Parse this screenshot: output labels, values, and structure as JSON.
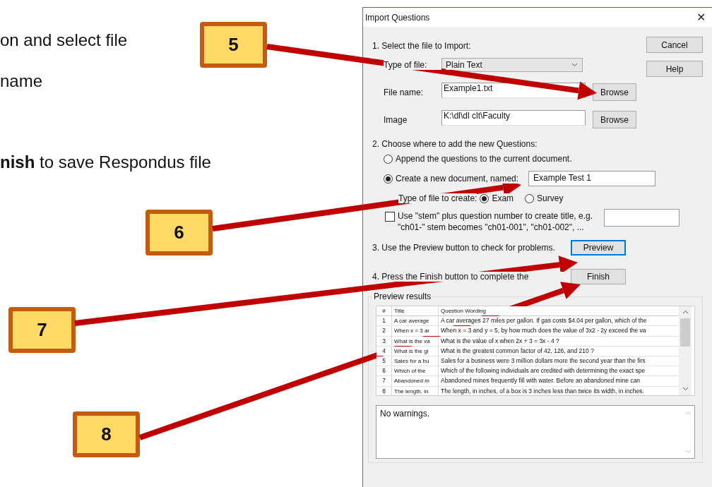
{
  "slide_text": [
    "on and select file",
    "name",
    "**nish** to save Respondus file"
  ],
  "callouts": [
    {
      "label": "5"
    },
    {
      "label": "6"
    },
    {
      "label": "7"
    },
    {
      "label": "8"
    }
  ],
  "dialog": {
    "title": "Import Questions",
    "close": "✕",
    "side_buttons": [
      {
        "label": "Cancel"
      },
      {
        "label": "Help"
      }
    ],
    "step1": "1.  Select the file to Import:",
    "type_of_file": {
      "label": "Type of file:",
      "value": "Plain Text"
    },
    "file_name": {
      "label": "File name:",
      "value": "Example1.txt",
      "button": "Browse"
    },
    "image": {
      "label": "Image",
      "value": "K:\\dl\\dl clt\\Faculty",
      "button": "Browse"
    },
    "step2": "2.  Choose where to add the new Questions:",
    "destinations": [
      {
        "label": "Append the questions to the current document.",
        "selected": false
      },
      {
        "label": "Create a new document, named:",
        "selected": true
      }
    ],
    "new_document_name": "Example Test 1",
    "file_type": {
      "label": "Type of file to create:",
      "options": [
        {
          "label": "Exam",
          "selected": true
        },
        {
          "label": "Survey",
          "selected": false
        }
      ]
    },
    "stem": {
      "checked": false,
      "line1": "Use \"stem\" plus question number to create title,  e.g.",
      "line2": "\"ch01-\" stem becomes \"ch01-001\",  \"ch01-002\",  ..."
    },
    "step3": {
      "text": "3.  Use the Preview button to check for problems.",
      "button": "Preview",
      "focused": true
    },
    "step4": {
      "text": "4.  Press the Finish button to complete the",
      "button": "Finish",
      "focused": false
    },
    "preview": {
      "legend": "Preview results",
      "columns": [
        "#",
        "Title",
        "Question Wording"
      ],
      "rows": [
        {
          "n": "1",
          "title": "A car average",
          "wording": "A car averages 27 miles per gallon. If gas costs $4.04 per gallon, which of the"
        },
        {
          "n": "2",
          "title": "When x = 3 ar",
          "wording": "When x = 3 and y = 5, by how much does the value of 3x2 - 2y exceed the va"
        },
        {
          "n": "3",
          "title": "What is the va",
          "wording": "What is the value of x when 2x + 3 = 3x - 4 ?"
        },
        {
          "n": "4",
          "title": "What is the gi",
          "wording": "What is the greatest common factor of 42, 126, and 210 ?"
        },
        {
          "n": "5",
          "title": "Sales for a bu",
          "wording": "Sales for a business were 3 million dollars more the second year than the firs"
        },
        {
          "n": "6",
          "title": "Which of the",
          "wording": "Which of the following individuals are credited with determining the exact spe"
        },
        {
          "n": "7",
          "title": "Abandoned m",
          "wording": "Abandoned mines frequently fill with water. Before an abandoned mine can"
        },
        {
          "n": "8",
          "title": "The length, in",
          "wording": "The length, in inches, of a box is 3 inches less than twice its width, in inches."
        }
      ],
      "warnings": "No warnings."
    }
  }
}
